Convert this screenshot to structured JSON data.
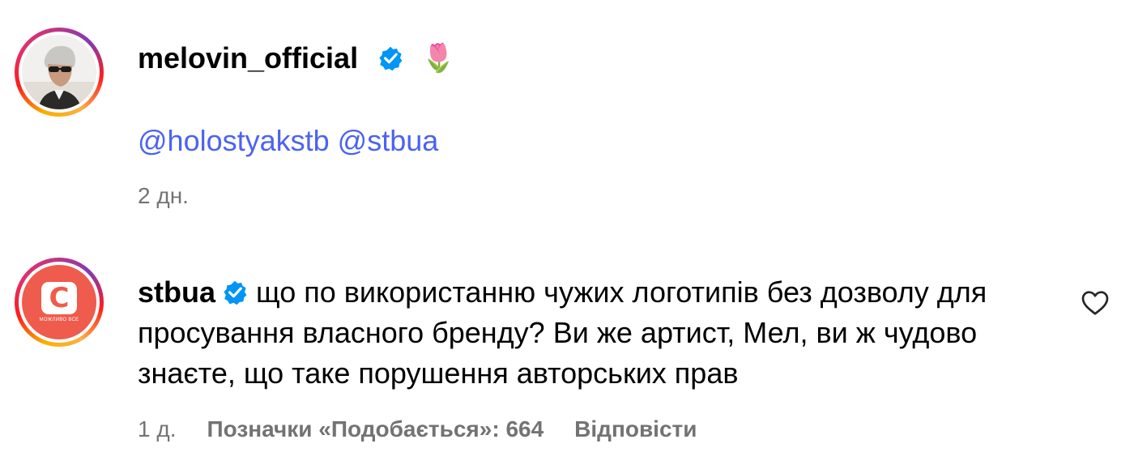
{
  "post": {
    "username": "melovin_official",
    "verified_icon": "verified-badge-icon",
    "emoji": "🌷",
    "mentions": [
      "@holostyakstb",
      "@stbua"
    ],
    "time": "2 дн."
  },
  "comment": {
    "username": "stbua",
    "verified_icon": "verified-badge-icon",
    "text": "що по використанню чужих логотипів без дозволу для просування власного бренду? Ви же артист, Мел, ви ж чудово знаєте, що таке порушення авторських прав",
    "avatar_logo_letter": "C",
    "avatar_caption": "МОЖЛИВО ВСЕ",
    "time": "1 д.",
    "likes": "Позначки «Подобається»: 664",
    "reply_label": "Відповісти",
    "like_icon": "heart-outline-icon"
  },
  "colors": {
    "mention": "#4b63f0",
    "verified": "#0095f6",
    "muted": "#737373",
    "stb_brand": "#ef5b4c"
  }
}
